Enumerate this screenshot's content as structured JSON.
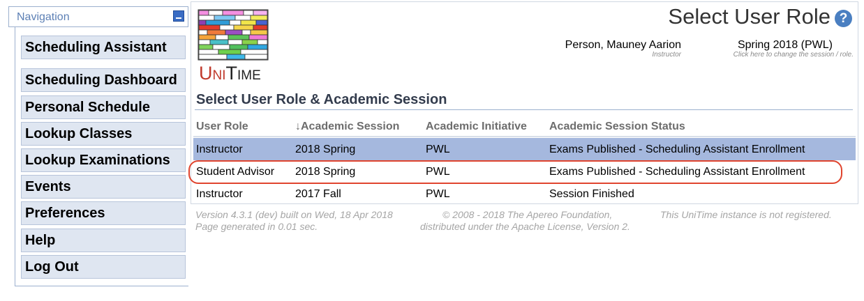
{
  "navigation": {
    "title": "Navigation",
    "items": [
      {
        "label": "Scheduling Assistant"
      },
      {
        "label": "Scheduling Dashboard"
      },
      {
        "label": "Personal Schedule"
      },
      {
        "label": "Lookup Classes"
      },
      {
        "label": "Lookup Examinations"
      },
      {
        "label": "Events"
      },
      {
        "label": "Preferences"
      },
      {
        "label": "Help"
      },
      {
        "label": "Log Out"
      }
    ]
  },
  "header": {
    "logo_text": "UniTime",
    "page_title": "Select User Role",
    "help_symbol": "?",
    "user_name": "Person, Mauney Aarion",
    "user_role": "Instructor",
    "session_name": "Spring 2018 (PWL)",
    "session_hint": "Click here to change the session / role."
  },
  "section": {
    "title": "Select User Role & Academic Session"
  },
  "table": {
    "headers": [
      "User Role",
      "↓Academic Session",
      "Academic Initiative",
      "Academic Session Status"
    ],
    "rows": [
      [
        "Instructor",
        "2018 Spring",
        "PWL",
        "Exams Published - Scheduling Assistant Enrollment"
      ],
      [
        "Student Advisor",
        "2018 Spring",
        "PWL",
        "Exams Published - Scheduling Assistant Enrollment"
      ],
      [
        "Instructor",
        "2017 Fall",
        "PWL",
        "Session Finished"
      ]
    ]
  },
  "footer": {
    "version": "Version 4.3.1 (dev) built on Wed, 18 Apr 2018",
    "generated": "Page generated in 0.01 sec.",
    "copyright": "© 2008 - 2018 The Apereo Foundation,",
    "license": "distributed under the Apache License, Version 2.",
    "registration": "This UniTime instance is not registered."
  },
  "colors": {
    "selected_row": "#a5b8de",
    "highlight_outline": "#e0442e",
    "nav_item_bg": "#dfe6f1",
    "help_icon": "#4a7fc1"
  },
  "icons": {
    "collapse": "collapse-icon",
    "help": "help-icon",
    "logo": "unitime-logo"
  }
}
